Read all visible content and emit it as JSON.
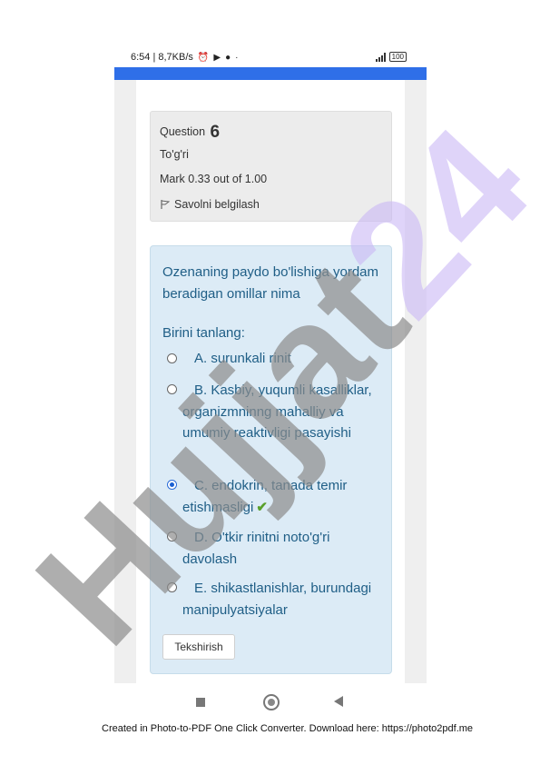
{
  "status_bar": {
    "time_speed": "6:54 | 8,7KB/s",
    "icons": [
      "alarm-icon",
      "play-icon",
      "facebook-icon",
      "dot-icon"
    ],
    "battery": "100"
  },
  "question_info": {
    "label": "Question",
    "number": "6",
    "state": "To'g'ri",
    "mark": "Mark 0.33 out of 1.00",
    "flag_label": "Savolni belgilash"
  },
  "question": {
    "text": "Ozenaning paydo bo'lishiga yordam beradigan omillar nima",
    "prompt": "Birini tanlang:",
    "options": [
      {
        "text": "A. surunkali rinit",
        "selected": false
      },
      {
        "text": "B. Kasbiy, yuqumli kasalliklar, organizmninng mahalliy va umumiy reaktivligi pasayishi",
        "selected": false
      },
      {
        "text": "C. endokrin, tanada temir etishmasligi",
        "selected": true,
        "correct_mark": "✔"
      },
      {
        "text": "D. O'tkir rinitni noto'g'ri davolash",
        "selected": false
      },
      {
        "text": "E. shikastlanishlar, burundagi manipulyatsiyalar",
        "selected": false
      }
    ],
    "check_button": "Tekshirish"
  },
  "nav_bar": {
    "icons": [
      "recent-apps-icon",
      "home-icon",
      "back-icon"
    ]
  },
  "watermark": {
    "text": "Hujjat24",
    "color": "#c9b8f5"
  },
  "footer": {
    "text": "Created in Photo-to-PDF One Click Converter. Download here: https://photo2pdf.me"
  },
  "colors": {
    "accent_blue": "#2f6fe8",
    "question_bg": "#dcebf6",
    "question_text": "#1f5e86",
    "correct_tick": "#5aa02c"
  }
}
